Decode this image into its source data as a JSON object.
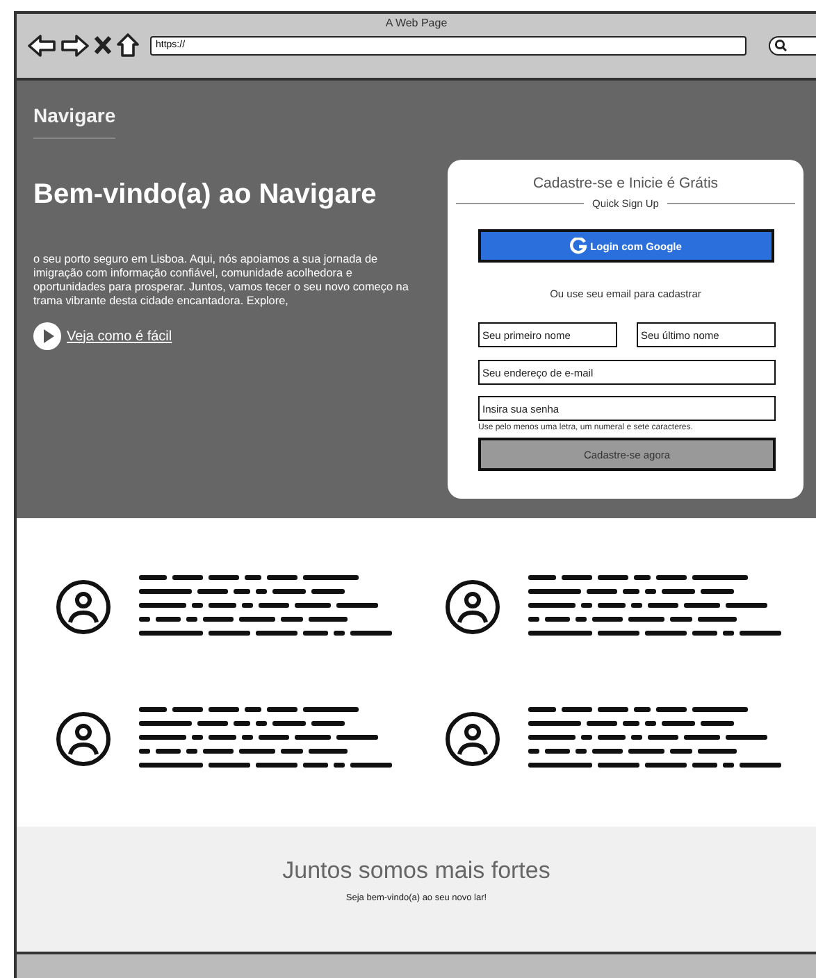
{
  "window": {
    "title": "A Web Page"
  },
  "browser": {
    "url": "https://"
  },
  "header": {
    "brand": "Navigare"
  },
  "hero": {
    "title": "Bem-vindo(a) ao Navigare",
    "text": "o seu porto seguro em Lisboa. Aqui, nós apoiamos a sua jornada de imigração com informação confiável, comunidade acolhedora e oportunidades para prosperar. Juntos, vamos tecer o seu novo começo na trama vibrante desta cidade encantadora. Explore,",
    "link": "Veja como é fácil"
  },
  "signup": {
    "title": "Cadastre-se e Inicie é Grátis",
    "divider": "Quick Sign Up",
    "google_button": "Login com Google",
    "alt_text": "Ou use seu email para cadastrar",
    "fields": [
      {
        "placeholder": "Seu primeiro nome"
      },
      {
        "placeholder": "Seu último nome"
      },
      {
        "placeholder": "Seu endereço de e-mail"
      },
      {
        "placeholder": "Insira sua senha"
      }
    ],
    "hint": "Use pelo menos uma letra, um numeral e sete caracteres.",
    "submit": "Cadastre-se agora"
  },
  "features": [
    {
      "kind": "user"
    },
    {
      "kind": "user"
    },
    {
      "kind": "user"
    },
    {
      "kind": "user"
    }
  ],
  "footer": {
    "title": "Juntos somos mais fortes",
    "subtitle": "Seja bem-vindo(a) ao seu novo lar!"
  }
}
